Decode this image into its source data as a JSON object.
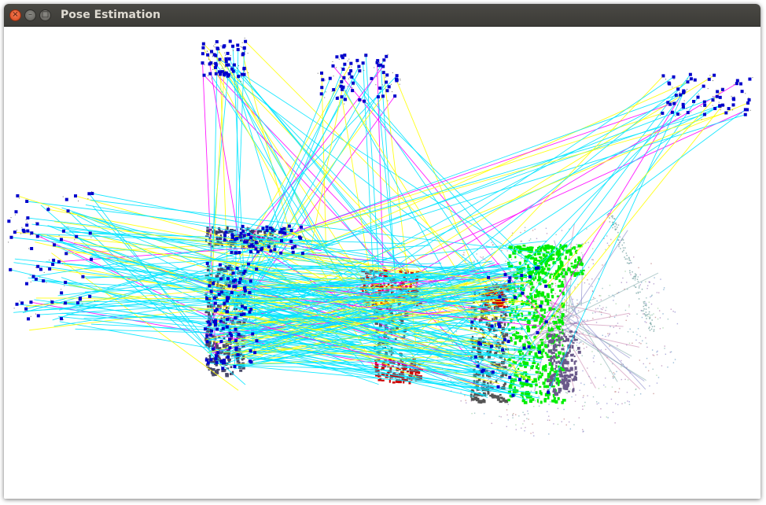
{
  "window": {
    "title": "Pose Estimation",
    "controls": {
      "close_glyph": "×",
      "minimize_glyph": "–",
      "maximize_glyph": "□"
    }
  },
  "viewport": {
    "background": "#ffffff",
    "match_line_colors": [
      "#00e5ff",
      "#ffff00",
      "#ff00ff"
    ],
    "keypoint_color": "#0000cc",
    "object_colors": [
      "#cc0000",
      "#00ee00",
      "#555555"
    ]
  }
}
